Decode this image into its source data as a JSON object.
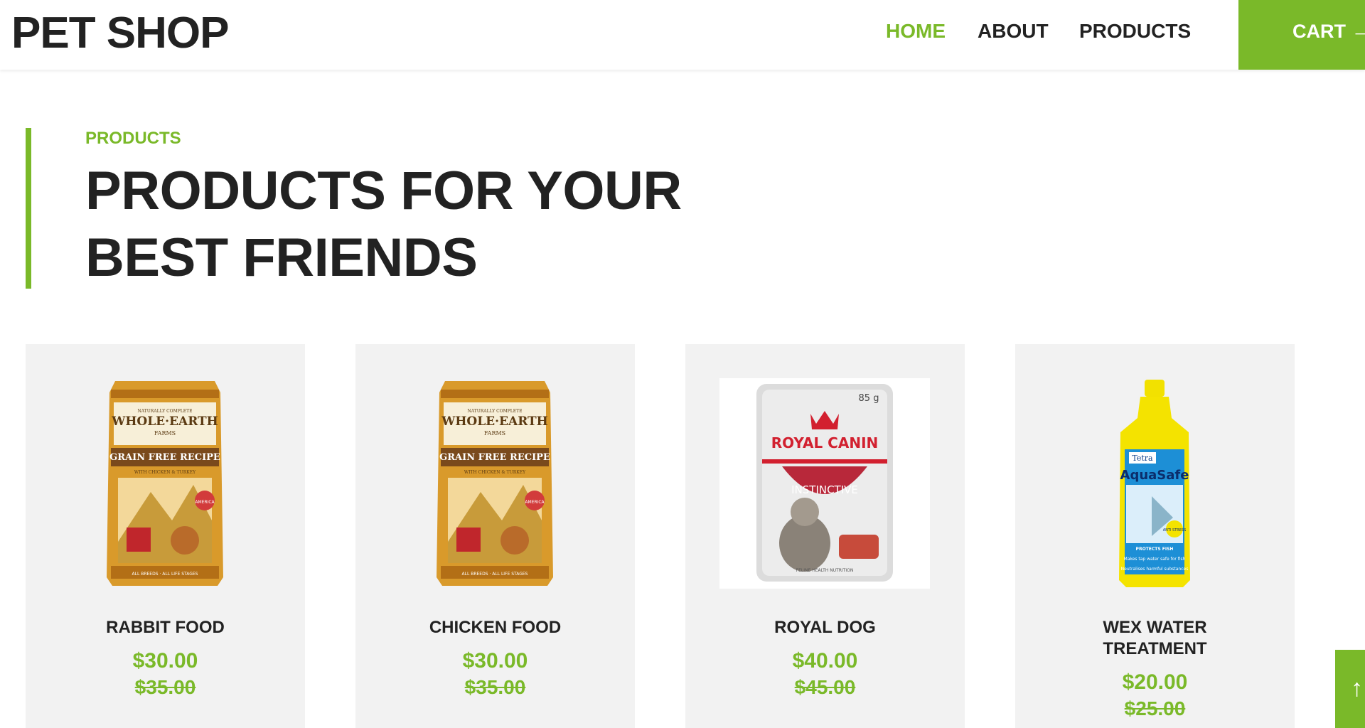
{
  "header": {
    "logo": "PET SHOP",
    "nav": [
      {
        "label": "HOME",
        "active": true
      },
      {
        "label": "ABOUT",
        "active": false
      },
      {
        "label": "PRODUCTS",
        "active": false
      }
    ],
    "cart_label": "CART",
    "cart_arrow": "→"
  },
  "section": {
    "kicker": "PRODUCTS",
    "title_line1": "PRODUCTS FOR YOUR",
    "title_line2": "BEST FRIENDS"
  },
  "products": [
    {
      "name": "RABBIT FOOD",
      "price": "$30.00",
      "old_price": "$35.00",
      "image": "whole-earth-bag-image"
    },
    {
      "name": "CHICKEN FOOD",
      "price": "$30.00",
      "old_price": "$35.00",
      "image": "whole-earth-bag-image"
    },
    {
      "name": "ROYAL DOG",
      "price": "$40.00",
      "old_price": "$45.00",
      "image": "royal-canin-pouch-image"
    },
    {
      "name_line1": "WEX WATER",
      "name_line2": "TREATMENT",
      "price": "$20.00",
      "old_price": "$25.00",
      "image": "aquasafe-bottle-image"
    }
  ],
  "package_text": {
    "whole_earth": {
      "top": "NATURALLY COMPLETE",
      "brand": "WHOLE·EARTH",
      "farms": "FARMS",
      "recipe": "GRAIN FREE RECIPE",
      "sub": "WITH CHICKEN & TURKEY",
      "badge": "AMERICA",
      "bottom": "ALL BREEDS · ALL LIFE STAGES"
    },
    "royal_canin": {
      "weight": "85 g",
      "brand": "ROYAL CANIN",
      "line": "INSTINCTIVE",
      "footer": "FELINE HEALTH NUTRITION"
    },
    "aquasafe": {
      "maker": "Tetra",
      "name": "AquaSafe",
      "tag": "PROTECTS FISH",
      "line1": "Makes tap water safe for fish",
      "line2": "Neutralises harmful substances",
      "badge": "ANTI STRESS"
    }
  },
  "scroll_top_icon": "↑",
  "colors": {
    "accent": "#7ab929",
    "card_bg": "#f2f2f2",
    "text": "#222222"
  }
}
